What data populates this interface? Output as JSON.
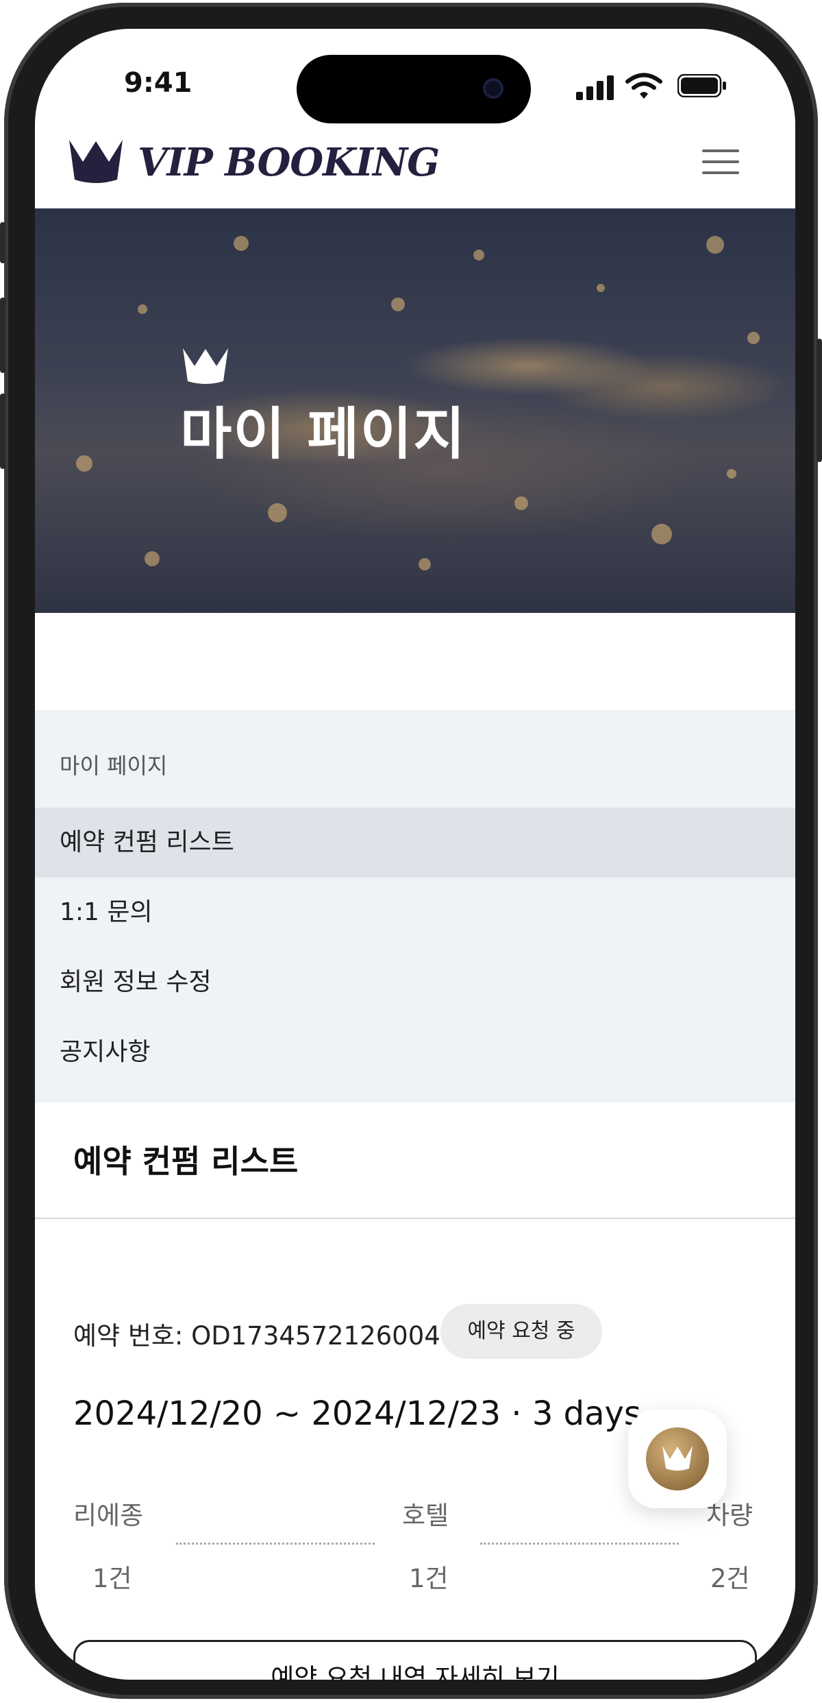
{
  "status_bar": {
    "time": "9:41"
  },
  "header": {
    "brand": "VIP BOOKING",
    "logo_icon": "crown-icon",
    "menu_icon": "hamburger-menu-icon"
  },
  "hero": {
    "title": "마이 페이지",
    "icon": "crown-icon"
  },
  "subnav": {
    "title": "마이 페이지",
    "items": [
      {
        "label": "예약 컨펌 리스트",
        "active": true
      },
      {
        "label": "1:1 문의",
        "active": false
      },
      {
        "label": "회원 정보 수정",
        "active": false
      },
      {
        "label": "공지사항",
        "active": false
      }
    ]
  },
  "section": {
    "title": "예약 컨펌 리스트"
  },
  "reservation": {
    "number_text": "예약 번호: OD1734572126004",
    "status_badge": "예약 요청 중",
    "dates": "2024/12/20 ~ 2024/12/23 · 3 days",
    "categories": [
      {
        "label": "리에종",
        "count": "1건"
      },
      {
        "label": "호텔",
        "count": "1건"
      },
      {
        "label": "차량",
        "count": "2건"
      }
    ],
    "detail_button": "예약 요청 내역 자세히 보기"
  },
  "fab": {
    "icon": "crown-icon"
  },
  "colors": {
    "brand": "#24213f",
    "subnav_bg": "#eff2f6",
    "active_item_bg": "#dfe2e8",
    "badge_bg": "#ececec",
    "gold": "#c9a46b"
  }
}
